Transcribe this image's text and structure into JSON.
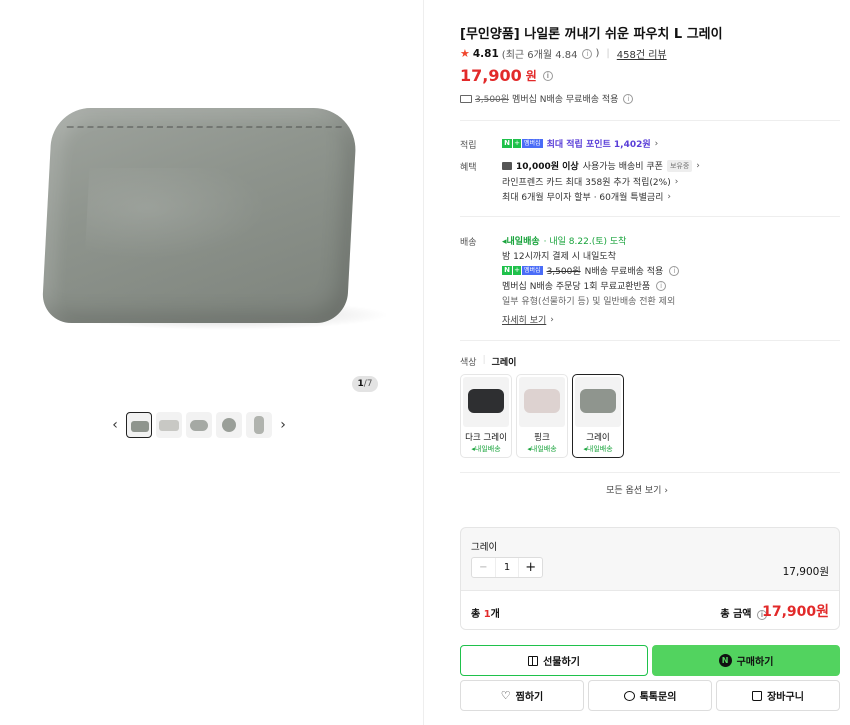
{
  "product": {
    "title": "[무인양품] 나일론 꺼내기 쉬운 파우치 L 그레이",
    "rating": "4.81",
    "rating_recent": "(최근 6개월 4.84",
    "review_count": "458건 리뷰",
    "price": "17,900",
    "price_unit": "원",
    "ship_orig": "3,500원",
    "ship_text": "멤버십 N배송 무료배송 적용"
  },
  "gallery": {
    "page_current": "1",
    "page_total": "/7"
  },
  "benefits": {
    "label_point": "적립",
    "point_text": "최대 적립 포인트 1,402원",
    "label_benefit": "혜택",
    "coupon_bold": "10,000원 이상",
    "coupon_text": "사용가능 배송비 쿠폰",
    "coupon_tag": "보유중",
    "card_text": "라인프렌즈 카드 최대 358원 추가 적립(2%)",
    "installment_text": "최대 6개월 무이자 할부 · 60개월 특별금리"
  },
  "delivery": {
    "label": "배송",
    "tomorrow_badge": "내일배송",
    "tomorrow_date": "· 내일 8.22.(토) 도착",
    "cutoff": "밤 12시까지 결제 시 내일도착",
    "n_orig": "3,500원",
    "n_free": "N배송 무료배송 적용",
    "exchange": "멤버십 N배송 주문당 1회 무료교환반품",
    "exclude": "일부 유형(선물하기 등) 및 일반배송 전환 제외",
    "more": "자세히 보기"
  },
  "options": {
    "label": "색상",
    "selected": "그레이",
    "items": [
      {
        "name": "다크 그레이",
        "delivery": "내일배송",
        "color": "#2e2f31"
      },
      {
        "name": "핑크",
        "delivery": "내일배송",
        "color": "#ddd2d0"
      },
      {
        "name": "그레이",
        "delivery": "내일배송",
        "color": "#8f958e"
      }
    ],
    "all_label": "모든 옵션 보기"
  },
  "cart": {
    "option_name": "그레이",
    "qty": "1",
    "minus": "−",
    "plus": "+",
    "line_price": "17,900원",
    "total_qty_prefix": "총 ",
    "total_qty": "1",
    "total_qty_suffix": "개",
    "total_label": "총 금액",
    "total_price": "17,900원"
  },
  "actions": {
    "gift": "선물하기",
    "buy": "구매하기",
    "wish": "찜하기",
    "talk": "톡톡문의",
    "cart": "장바구니"
  }
}
